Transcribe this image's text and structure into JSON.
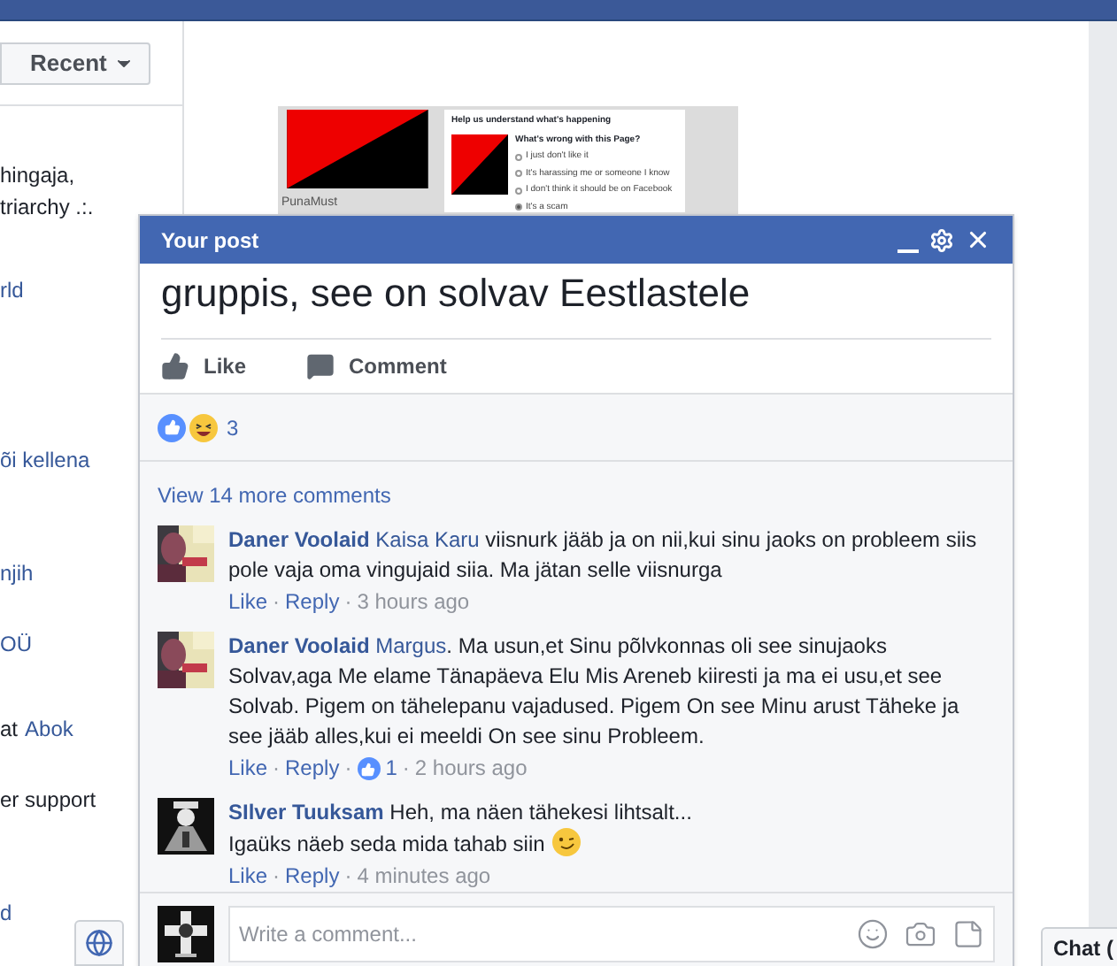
{
  "feed": {
    "sort_menu": {
      "label": "Recent"
    },
    "left_snippets": [
      {
        "parts": [
          {
            "text": "hingaja,",
            "kind": "text"
          }
        ]
      },
      {
        "parts": [
          {
            "text": "triarchy .:.",
            "kind": "text"
          }
        ]
      },
      {
        "parts": [
          {
            "text": "rld",
            "kind": "link"
          }
        ]
      },
      {
        "parts": [
          {
            "text": "õi kellena",
            "kind": "link"
          }
        ]
      },
      {
        "parts": [
          {
            "text": "njih",
            "kind": "link"
          }
        ]
      },
      {
        "parts": [
          {
            "text": "OÜ",
            "kind": "link"
          }
        ]
      },
      {
        "parts": [
          {
            "text": "at",
            "kind": "text"
          },
          {
            "text": "Abok",
            "kind": "link"
          }
        ]
      },
      {
        "parts": [
          {
            "text": "er support",
            "kind": "text"
          }
        ]
      },
      {
        "parts": [
          {
            "text": "d",
            "kind": "link"
          }
        ]
      }
    ],
    "shared_image": {
      "page_name": "PunaMust",
      "dialog": {
        "title": "Help us understand what's happening",
        "question": "What's wrong with this Page?",
        "options": [
          {
            "label": "I just don't like it",
            "selected": false
          },
          {
            "label": "It's harassing me or someone I know",
            "selected": false
          },
          {
            "label": "I don't think it should be on Facebook",
            "selected": false
          },
          {
            "label": "It's a scam",
            "selected": true
          }
        ]
      }
    },
    "chat": {
      "label": "Chat ("
    }
  },
  "post_window": {
    "title": "Your post",
    "post_text": "gruppis, see on solvav Eestlastele",
    "actions": [
      {
        "label": "Like",
        "kind": "like"
      },
      {
        "label": "Comment",
        "kind": "comment"
      }
    ],
    "reactions": {
      "count": "3"
    },
    "more_comments": "View 14 more comments",
    "comments": [
      {
        "author": "Daner Voolaid",
        "tag": "Kaisa Karu",
        "text": " viisnurk jääb ja on nii,kui sinu jaoks on probleem siis pole vaja oma vingujaid siia. Ma jätan selle viisnurga",
        "emoji": false,
        "meta": [
          {
            "kind": "link",
            "text": "Like"
          },
          {
            "kind": "sep",
            "text": "·"
          },
          {
            "kind": "link",
            "text": "Reply"
          },
          {
            "kind": "sep",
            "text": "·"
          },
          {
            "kind": "time",
            "text": "3 hours ago"
          }
        ]
      },
      {
        "author": "Daner Voolaid",
        "tag": "Margus",
        "text": ". Ma usun,et Sinu põlvkonnas oli see sinujaoks Solvav,aga Me elame Tänapäeva Elu Mis Areneb kiiresti ja ma ei usu,et see Solvab. Pigem on tähelepanu vajadused. Pigem On see Minu arust Täheke ja see jääb alles,kui ei meeldi On see sinu Probleem.",
        "emoji": false,
        "meta": [
          {
            "kind": "link",
            "text": "Like"
          },
          {
            "kind": "sep",
            "text": "·"
          },
          {
            "kind": "link",
            "text": "Reply"
          },
          {
            "kind": "sep",
            "text": "·"
          },
          {
            "kind": "likes",
            "text": "1"
          },
          {
            "kind": "sep",
            "text": "·"
          },
          {
            "kind": "time",
            "text": "2 hours ago"
          }
        ]
      },
      {
        "author": "SIlver Tuuksam",
        "text": " Heh, ma näen tähekesi lihtsalt...\nIgaüks näeb seda mida tahab siin",
        "emoji": true,
        "avatar": {
          "kind": "dark"
        },
        "meta": [
          {
            "kind": "link",
            "text": "Like"
          },
          {
            "kind": "sep",
            "text": "·"
          },
          {
            "kind": "link",
            "text": "Reply"
          },
          {
            "kind": "sep",
            "text": "·"
          },
          {
            "kind": "time",
            "text": "4 minutes ago"
          }
        ]
      }
    ],
    "composer": {
      "placeholder": "Write a comment..."
    }
  }
}
